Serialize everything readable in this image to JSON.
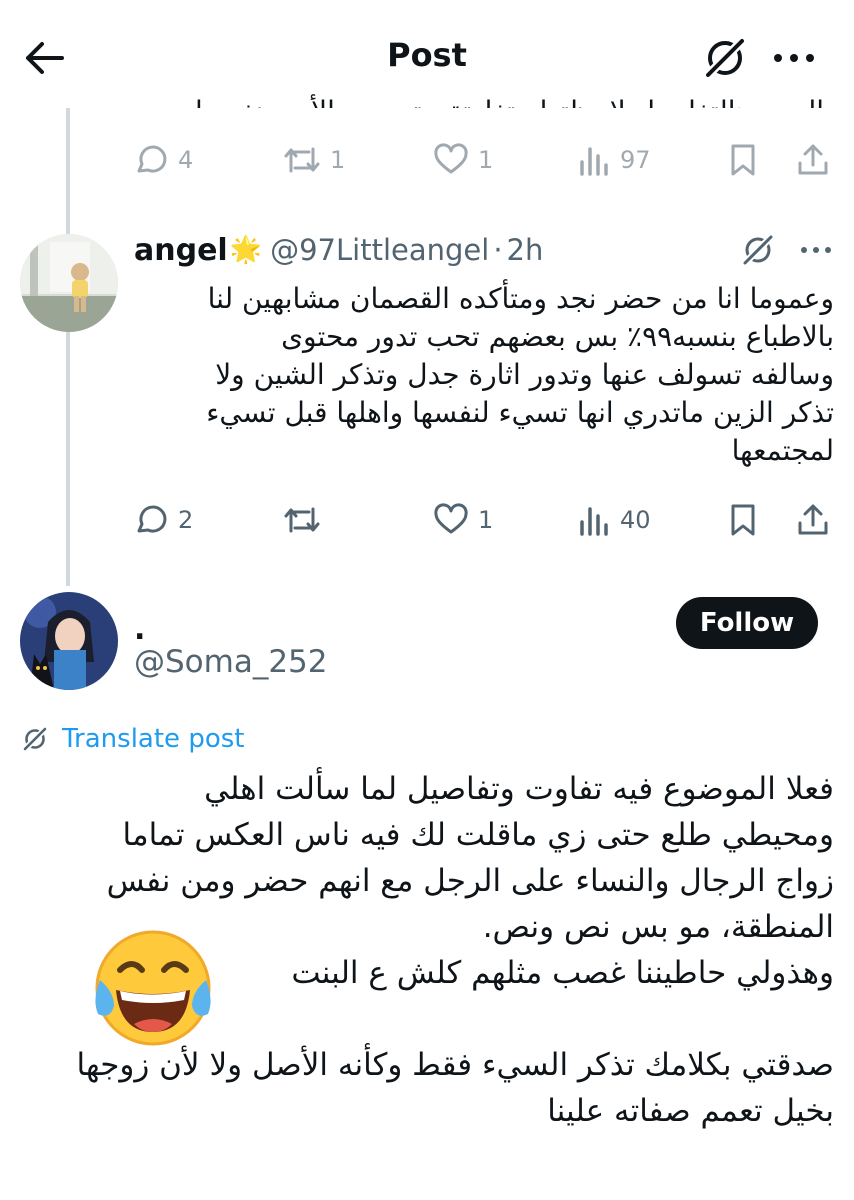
{
  "header": {
    "back_icon": "arrow-left-icon",
    "title": "Post",
    "grok_icon": "grok-icon",
    "more_icon": "more-horizontal-icon"
  },
  "parent_reply": {
    "clipped_text": "المهم هالتفاصيل لاحظتها متفاوتة حتى بين الأسر نفسها",
    "actions": {
      "replies": "4",
      "reposts": "1",
      "likes": "1",
      "views": "97"
    }
  },
  "reply_angel": {
    "display_name": "angel",
    "badge_emoji": "🌟",
    "handle": "@97Littleangel",
    "separator": "·",
    "time": "2h",
    "text": "وعموما انا من حضر نجد ومتأكده القصمان مشابهين لنا\nبالاطباع بنسبه٩٩٪ بس بعضهم تحب تدور محتوى\nوسالفه تسولف عنها وتدور اثارة جدل وتذكر الشين ولا\nتذكر الزين ماتدري انها تسيء لنفسها واهلها قبل تسيء\nلمجتمعها",
    "actions": {
      "replies": "2",
      "reposts": "",
      "likes": "1",
      "views": "40"
    }
  },
  "main_post": {
    "display_name": ".",
    "handle": "@Soma_252",
    "follow_label": "Follow",
    "translate_label": "Translate post",
    "text": "فعلا الموضوع فيه تفاوت وتفاصيل لما سألت اهلي\nومحيطي طلع حتى زي ماقلت لك فيه ناس العكس تماما\nزواج الرجال والنساء على الرجل مع انهم حضر ومن نفس\nالمنطقة، مو بس نص ونص.\nوهذولي حاطيننا غصب مثلهم كلش ع البنت\n\nصدقتي بكلامك تذكر السيء فقط وكأنه الأصل ولا لأن زوجها\nبخيل تعمم صفاته علينا",
    "emoji": "face-with-tears-of-joy"
  },
  "colors": {
    "text": "#0f1419",
    "secondary": "#536471",
    "link": "#1d9bf0",
    "thread_line": "#cfd9de",
    "follow_bg": "#0f1419"
  }
}
